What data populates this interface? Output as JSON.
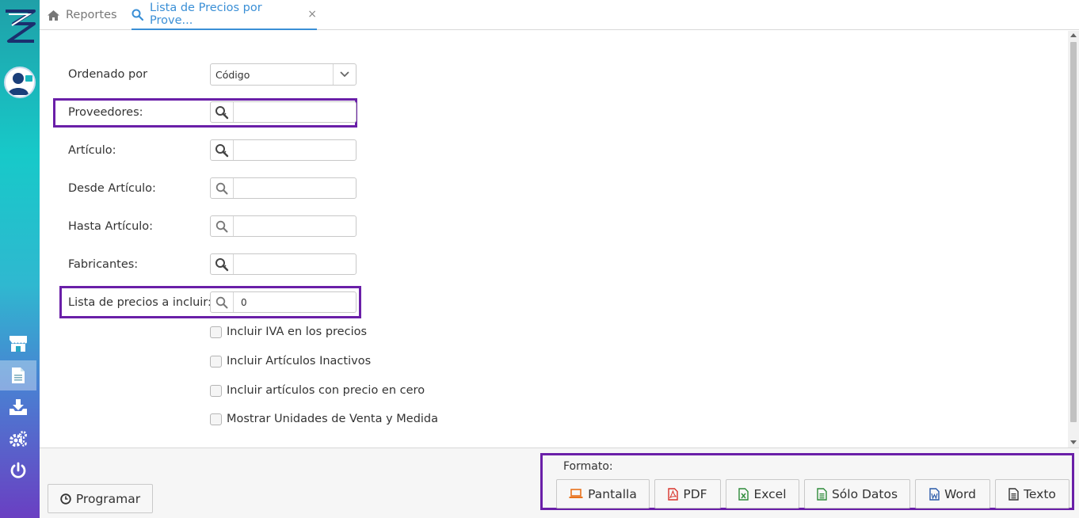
{
  "tabs": {
    "home_label": "Reportes",
    "active_label": "Lista de Precios por Prove...",
    "close_glyph": "×"
  },
  "form": {
    "ordenado_label": "Ordenado por",
    "ordenado_value": "Código",
    "proveedores_label": "Proveedores:",
    "articulo_label": "Artículo:",
    "desde_label": "Desde Artículo:",
    "hasta_label": "Hasta Artículo:",
    "fabricantes_label": "Fabricantes:",
    "lista_label": "Lista de precios a incluir:",
    "lista_value": "0"
  },
  "checks": [
    {
      "label": "Incluir IVA en los precios",
      "checked": false
    },
    {
      "label": "Incluir Artículos Inactivos",
      "checked": false
    },
    {
      "label": "Incluir artículos con precio en cero",
      "checked": false
    },
    {
      "label": "Mostrar Unidades de Venta y Medida",
      "checked": false
    }
  ],
  "footer": {
    "programar_label": "Programar",
    "formato_label": "Formato:",
    "buttons": {
      "pantalla": "Pantalla",
      "pdf": "PDF",
      "excel": "Excel",
      "solo_datos": "Sólo Datos",
      "word": "Word",
      "texto": "Texto"
    }
  },
  "icons": {
    "tab_home": "home-icon",
    "tab_active": "search-icon",
    "sidebar": [
      "store-icon",
      "document-icon",
      "download-icon",
      "settings-icon",
      "power-icon"
    ]
  },
  "colors": {
    "accent": "#3a8fd6",
    "highlight": "#6a1fa8",
    "pdf": "#d9342b",
    "excel": "#2e8b3a",
    "word": "#2a5aa8",
    "pantalla": "#e8721c"
  }
}
